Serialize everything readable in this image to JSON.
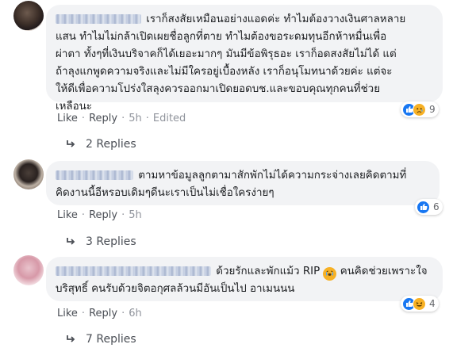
{
  "comments": [
    {
      "text_lines": [
        "เราก็สงสัยเหมือนอย่างแอดค่ะ ทำไมต้องวางเงินศาลหลาย",
        "แสน ทำไมไม่กล้าเปิดเผยชื่อลูกที่ตาย ทำไมต้องขอระดมทุนอีกห้าหมื่นเพื่อ",
        "ผ่าตา ทั้งๆที่เงินบริจาคก็ได้เยอะมากๆ มันมีข้อพิรุธอะ เราก็อดสงสัยไม่ได้ แต่",
        "ถ้าลุงแกพูดความจริงและไม่มีใครอยู่เบื้องหลัง เราก็อนุโมทนาด้วยค่ะ แต่จะ",
        "ให้ดีเพื่อความโปร่งใสลุงควรออกมาเปิดยอดบช.และขอบคุณทุกคนที่ช่วย",
        "เหลือนะ"
      ],
      "reaction_count": "9",
      "reaction_icons": [
        "like-icon",
        "sad-icon"
      ],
      "actions": {
        "like": "Like",
        "reply": "Reply",
        "time": "5h",
        "edited": "Edited"
      },
      "replies": "2 Replies"
    },
    {
      "text_lines": [
        "ตามหาข้อมูลลูกตามาสักพักไม่ได้ความกระจ่างเลยคิดตามที่",
        "คิดงานนี้อีหรอบเดิมๆดีนะเราเป็นไม่เชื่อใครง่ายๆ"
      ],
      "reaction_count": "6",
      "reaction_icons": [
        "like-icon"
      ],
      "actions": {
        "like": "Like",
        "reply": "Reply",
        "time": "5h"
      },
      "replies": "3 Replies"
    },
    {
      "text_lines": [
        "ด้วยรักและพักแม้ว RIP",
        "คนคิดช่วยเพราะใจ",
        "บริสุทธิ์ คนรับด้วยจิตอกุศลล้วนมีอันเป็นไป อาเมนนน"
      ],
      "reaction_count": "4",
      "reaction_icons": [
        "like-icon",
        "haha-icon"
      ],
      "actions": {
        "like": "Like",
        "reply": "Reply",
        "time": "6h"
      },
      "replies": "7 Replies"
    }
  ],
  "colors": {
    "bubble": "#f2f3f5",
    "like_blue": "#1877f2",
    "emoji_yellow": "#f7b125",
    "meta_gray": "#90949c"
  }
}
